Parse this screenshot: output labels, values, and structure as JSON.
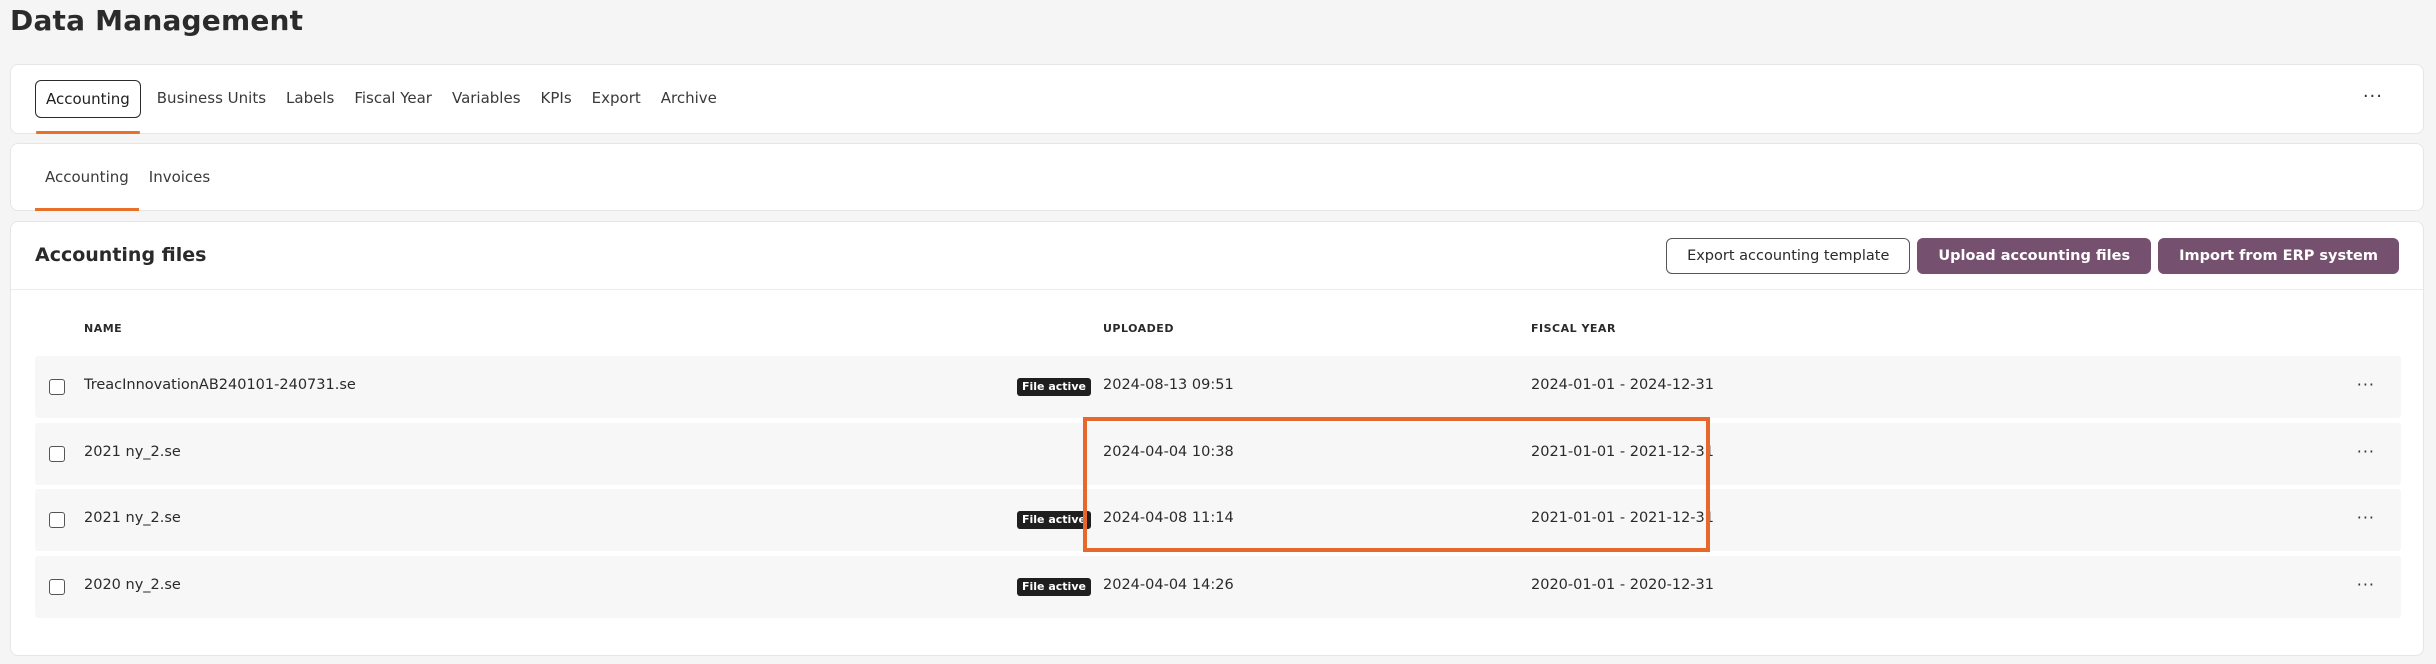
{
  "page": {
    "title": "Data Management"
  },
  "tabs": [
    "Accounting",
    "Business Units",
    "Labels",
    "Fiscal Year",
    "Variables",
    "KPIs",
    "Export",
    "Archive"
  ],
  "active_tab": "Accounting",
  "more_label": "···",
  "subtabs": [
    "Accounting",
    "Invoices"
  ],
  "active_subtab": "Accounting",
  "files": {
    "title": "Accounting files",
    "actions": {
      "export_template": "Export accounting template",
      "upload": "Upload accounting files",
      "import_erp": "Import from ERP system"
    },
    "columns": {
      "name": "NAME",
      "uploaded": "UPLOADED",
      "fiscal_year": "FISCAL YEAR"
    },
    "rows": [
      {
        "name": "TreacInnovationAB240101-240731.se",
        "badge": "File active",
        "uploaded": "2024-08-13 09:51",
        "fiscal_year": "2024-01-01 - 2024-12-31"
      },
      {
        "name": "2021 ny_2.se",
        "badge": "",
        "uploaded": "2024-04-04 10:38",
        "fiscal_year": "2021-01-01 - 2021-12-31"
      },
      {
        "name": "2021 ny_2.se",
        "badge": "File active",
        "uploaded": "2024-04-08 11:14",
        "fiscal_year": "2021-01-01 - 2021-12-31"
      },
      {
        "name": "2020 ny_2.se",
        "badge": "File active",
        "uploaded": "2024-04-04 14:26",
        "fiscal_year": "2020-01-01 - 2020-12-31"
      }
    ]
  },
  "colors": {
    "accent": "#e8702a",
    "primary_button": "#76506f",
    "highlight": "#e8672a",
    "badge": "#1f1f1f"
  }
}
